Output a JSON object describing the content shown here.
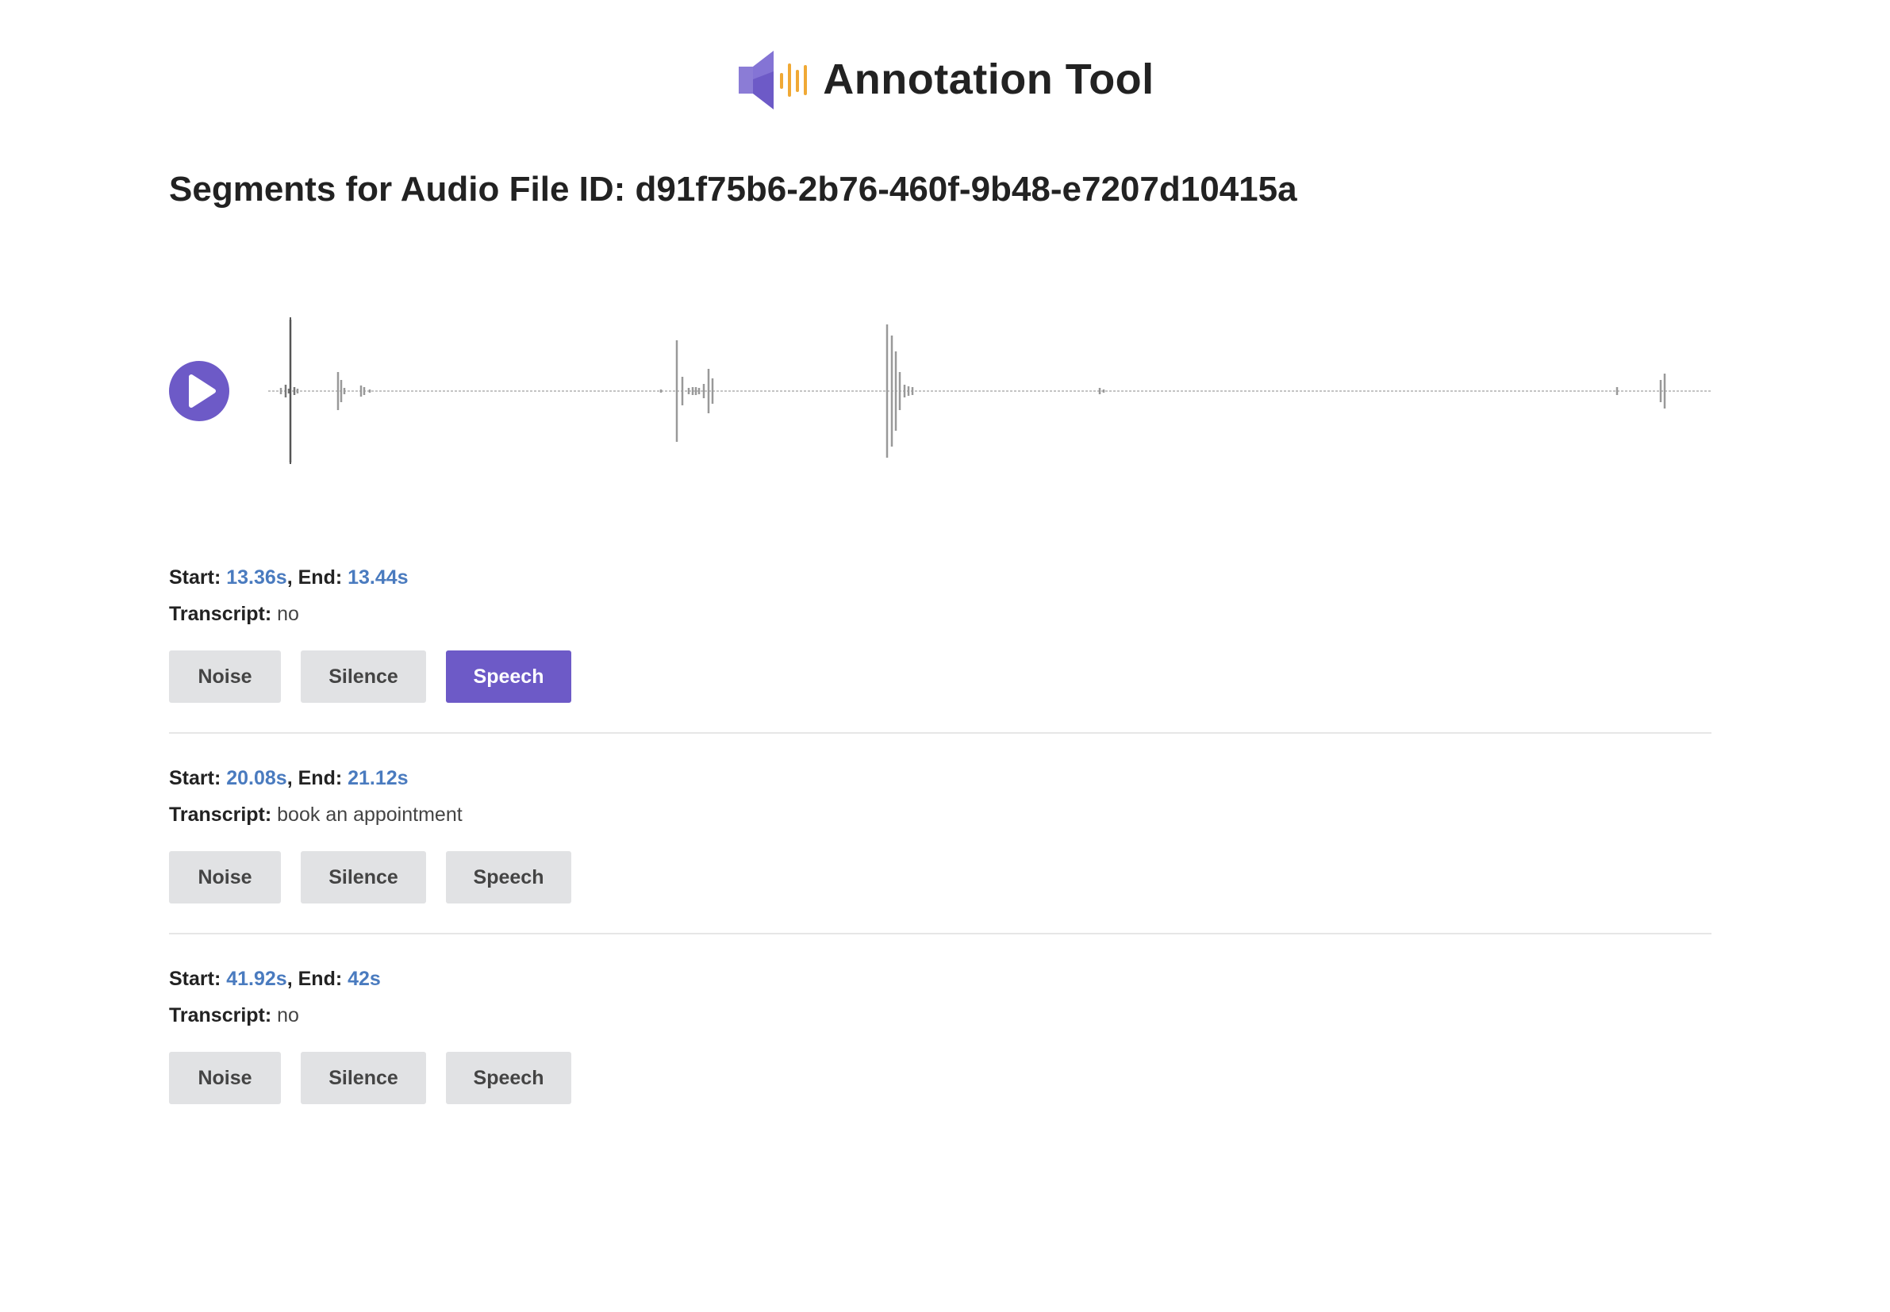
{
  "app": {
    "title": "Annotation Tool",
    "logo_icon": "speaker-waveform-icon"
  },
  "page": {
    "heading": "Segments for Audio File ID: d91f75b6-2b76-460f-9b48-e7207d10415a"
  },
  "player": {
    "play_icon": "play-icon"
  },
  "labels": {
    "start": "Start:",
    "end": "End:",
    "transcript": "Transcript:"
  },
  "segments": [
    {
      "start": "13.36s",
      "end": "13.44s",
      "transcript": "no",
      "selected": "Speech"
    },
    {
      "start": "20.08s",
      "end": "21.12s",
      "transcript": "book an appointment",
      "selected": ""
    },
    {
      "start": "41.92s",
      "end": "42s",
      "transcript": "no",
      "selected": ""
    }
  ],
  "buttons": {
    "noise": "Noise",
    "silence": "Silence",
    "speech": "Speech"
  },
  "colors": {
    "accent": "#6d5ac7",
    "time": "#4a7bbf",
    "button_bg": "#e1e2e4",
    "logo_bars": "#f0a935"
  }
}
